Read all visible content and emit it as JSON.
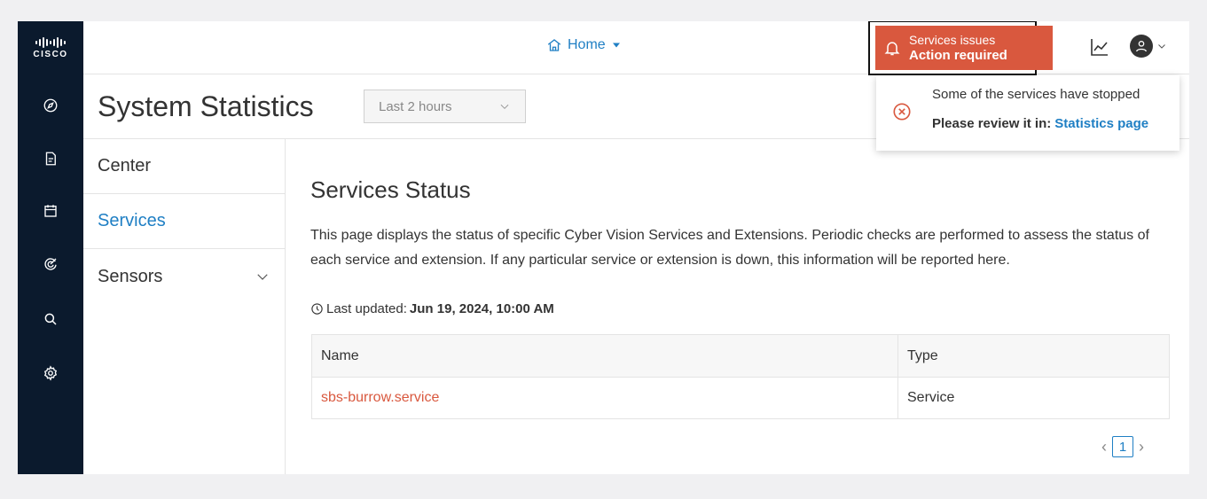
{
  "brand": {
    "logo_text": "CISCO"
  },
  "rail": {
    "items": [
      {
        "icon": "compass-icon"
      },
      {
        "icon": "report-icon"
      },
      {
        "icon": "calendar-icon"
      },
      {
        "icon": "radar-icon"
      },
      {
        "icon": "search-icon"
      },
      {
        "icon": "gear-icon"
      }
    ]
  },
  "topbar": {
    "home_label": "Home",
    "alert": {
      "line1": "Services issues",
      "line2": "Action required",
      "color": "#d9583e"
    }
  },
  "page": {
    "title": "System Statistics",
    "range_select": {
      "value": "Last 2 hours"
    }
  },
  "subnav": {
    "items": [
      {
        "label": "Center"
      },
      {
        "label": "Services"
      },
      {
        "label": "Sensors"
      }
    ]
  },
  "main": {
    "section_title": "Services Status",
    "description": "This page displays the status of specific Cyber Vision Services and Extensions. Periodic checks are performed to assess the status of each service and extension. If any particular service or extension is down, this information will be reported here.",
    "last_updated_label": "Last updated:",
    "last_updated_value": "Jun 19, 2024, 10:00 AM",
    "table": {
      "headers": [
        "Name",
        "Type"
      ],
      "rows": [
        {
          "name": "sbs-burrow.service",
          "type": "Service"
        }
      ]
    },
    "pagination": {
      "current_page": "1"
    }
  },
  "popover": {
    "line1": "Some of the services have stopped",
    "line2_prefix": "Please review it in:",
    "link": "Statistics page"
  },
  "colors": {
    "accent": "#1f7fc4",
    "alert": "#d9583e",
    "rail": "#0b1a2d"
  }
}
